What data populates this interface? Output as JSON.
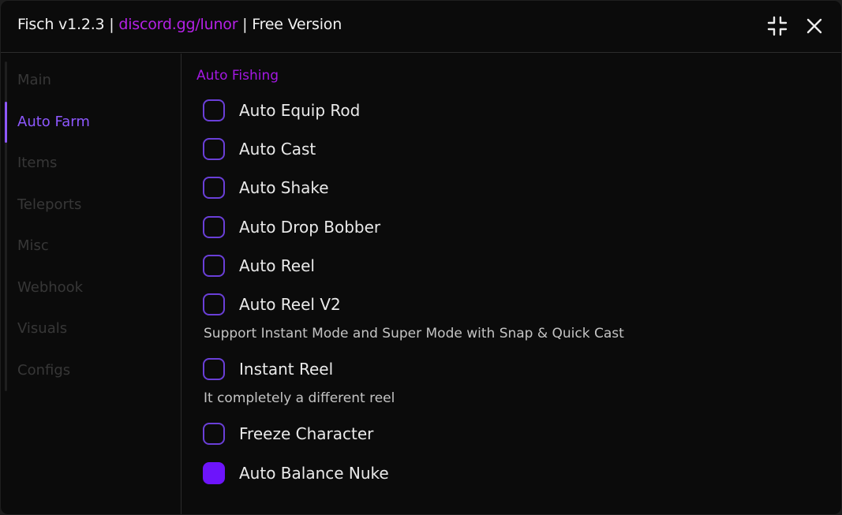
{
  "window": {
    "title_prefix": "Fisch v1.2.3 | ",
    "title_link": "discord.gg/lunor",
    "title_suffix": " | Free Version",
    "minimize_icon": "compress-icon",
    "close_icon": "close-icon"
  },
  "sidebar": {
    "items": [
      {
        "label": "Main",
        "active": false
      },
      {
        "label": "Auto Farm",
        "active": true
      },
      {
        "label": "Items",
        "active": false
      },
      {
        "label": "Teleports",
        "active": false
      },
      {
        "label": "Misc",
        "active": false
      },
      {
        "label": "Webhook",
        "active": false
      },
      {
        "label": "Visuals",
        "active": false
      },
      {
        "label": "Configs",
        "active": false
      }
    ]
  },
  "content": {
    "section_title": "Auto Fishing",
    "toggles": [
      {
        "label": "Auto Equip Rod",
        "checked": false
      },
      {
        "label": "Auto Cast",
        "checked": false
      },
      {
        "label": "Auto Shake",
        "checked": false
      },
      {
        "label": "Auto Drop Bobber",
        "checked": false
      },
      {
        "label": "Auto Reel",
        "checked": false
      },
      {
        "label": "Auto Reel V2",
        "checked": false,
        "description": "Support Instant Mode and Super Mode with Snap & Quick Cast"
      },
      {
        "label": "Instant Reel",
        "checked": false,
        "description": "It completely a different reel"
      },
      {
        "label": "Freeze Character",
        "checked": false
      },
      {
        "label": "Auto Balance Nuke",
        "checked": true
      }
    ]
  },
  "colors": {
    "accent": "#8e58ff",
    "link": "#b421e6",
    "section_title": "#a418e3",
    "checkbox_border": "#6a3fd8",
    "checkbox_checked": "#6d14fb",
    "background": "#0b0b0b"
  }
}
